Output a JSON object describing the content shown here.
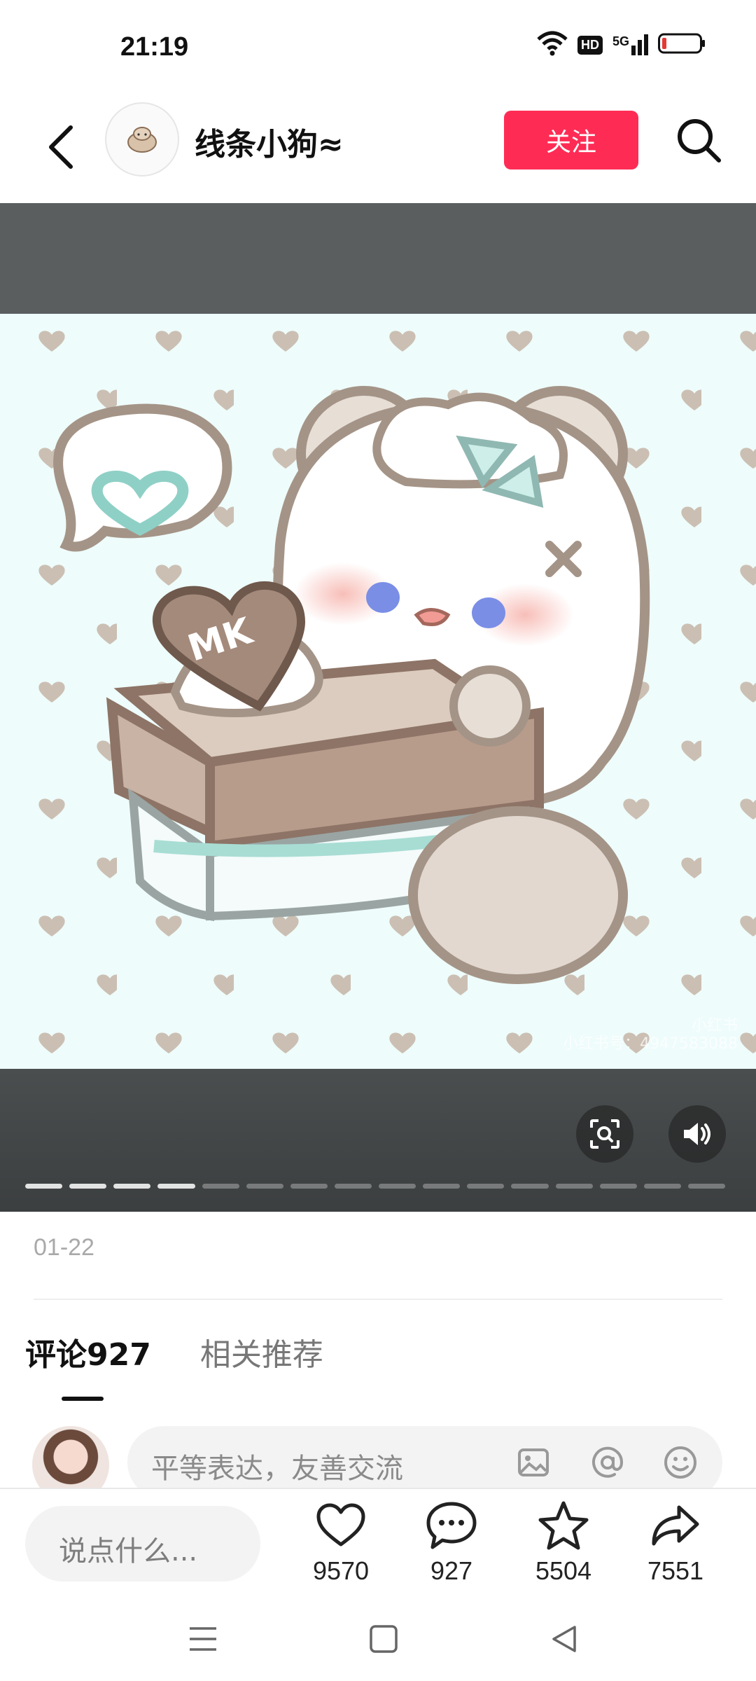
{
  "status_bar": {
    "time": "21:19",
    "icons": [
      "wifi-icon",
      "hd-icon",
      "signal-5g-icon",
      "battery-low-icon"
    ],
    "hd_label": "HD",
    "network_label": "5G"
  },
  "header": {
    "author_name": "线条小狗≈",
    "follow_label": "关注",
    "follow_color": "#fe2c55"
  },
  "media": {
    "progress": {
      "total_segments": 16,
      "current_segment": 4
    },
    "watermark": [
      "小红书",
      "小红书号：4947583088"
    ]
  },
  "post": {
    "date": "01-22"
  },
  "tabs": [
    {
      "label": "评论927",
      "active": true
    },
    {
      "label": "相关推荐",
      "active": false
    }
  ],
  "comment_box": {
    "placeholder": "平等表达，友善交流"
  },
  "action_bar": {
    "input_placeholder": "说点什么...",
    "likes": "9570",
    "comments": "927",
    "favorites": "5504",
    "shares": "7551"
  }
}
